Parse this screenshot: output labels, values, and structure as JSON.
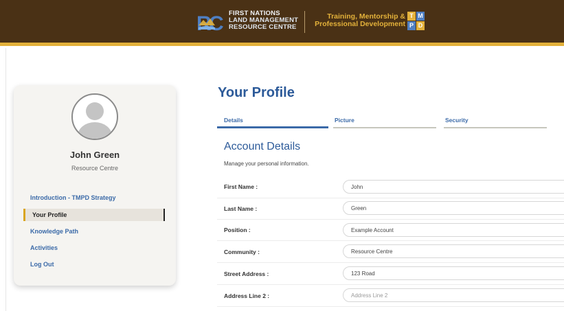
{
  "header": {
    "logo_lines": [
      "FIRST NATIONS",
      "LAND MANAGEMENT",
      "RESOURCE CENTRE"
    ],
    "program_lines": [
      "Training, Mentorship &",
      "Professional Development"
    ],
    "program_badge": [
      "T",
      "M",
      "P",
      "D"
    ],
    "colors": {
      "bar": "#4a3115",
      "accent": "#e3b13a"
    }
  },
  "sidebar": {
    "user_name": "John Green",
    "user_org": "Resource Centre",
    "nav": [
      {
        "label": "Introduction - TMPD Strategy"
      },
      {
        "label": "Your Profile",
        "active": true
      },
      {
        "label": "Knowledge Path"
      },
      {
        "label": "Activities"
      },
      {
        "label": "Log Out"
      }
    ]
  },
  "main": {
    "title": "Your Profile",
    "tabs": [
      {
        "label": "Details",
        "active": true
      },
      {
        "label": "Picture"
      },
      {
        "label": "Security"
      }
    ],
    "section_title": "Account Details",
    "section_sub": "Manage your personal information.",
    "fields": [
      {
        "label": "First Name :",
        "value": "John",
        "placeholder": ""
      },
      {
        "label": "Last Name :",
        "value": "Green",
        "placeholder": ""
      },
      {
        "label": "Position :",
        "value": "Example Account",
        "placeholder": ""
      },
      {
        "label": "Community :",
        "value": "Resource Centre",
        "placeholder": ""
      },
      {
        "label": "Street Address :",
        "value": "123 Road",
        "placeholder": ""
      },
      {
        "label": "Address Line 2 :",
        "value": "",
        "placeholder": "Address Line 2"
      }
    ]
  }
}
